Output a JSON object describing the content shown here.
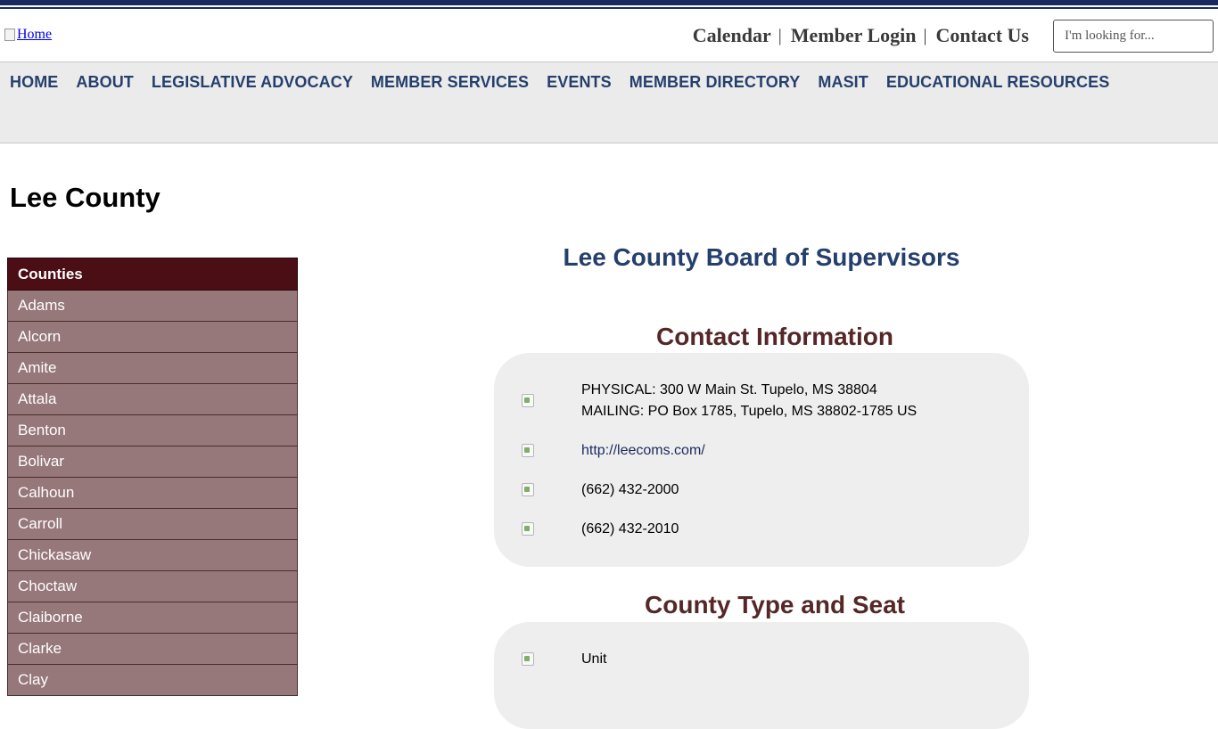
{
  "header": {
    "home_logo_alt": "Home",
    "util_links": [
      "Calendar",
      "Member Login",
      "Contact Us"
    ],
    "util_separator": "|",
    "search_placeholder": "I'm looking for..."
  },
  "nav": {
    "items": [
      "HOME",
      "ABOUT",
      "LEGISLATIVE ADVOCACY",
      "MEMBER SERVICES",
      "EVENTS",
      "MEMBER DIRECTORY",
      "MASIT",
      "EDUCATIONAL RESOURCES"
    ]
  },
  "page": {
    "title": "Lee County"
  },
  "sidebar": {
    "heading": "Counties",
    "items": [
      "Adams",
      "Alcorn",
      "Amite",
      "Attala",
      "Benton",
      "Bolivar",
      "Calhoun",
      "Carroll",
      "Chickasaw",
      "Choctaw",
      "Claiborne",
      "Clarke",
      "Clay"
    ]
  },
  "main": {
    "org_title": "Lee County Board of Supervisors",
    "contact": {
      "title": "Contact Information",
      "physical": "PHYSICAL: 300 W Main St. Tupelo, MS 38804",
      "mailing": "MAILING: PO Box 1785, Tupelo, MS 38802-1785 US",
      "website": "http://leecoms.com/",
      "phone": "(662) 432-2000",
      "fax": "(662) 432-2010"
    },
    "county_type": {
      "title": "County Type and Seat",
      "type": "Unit"
    }
  },
  "colors": {
    "navy": "#1b2a5e",
    "nav_text": "#253f6d",
    "sidebar_head": "#4a0e14",
    "sidebar_item": "#96777a",
    "section_title": "#552727"
  },
  "icons": [
    "address-icon",
    "website-icon",
    "phone-icon",
    "fax-icon",
    "county-type-icon"
  ]
}
